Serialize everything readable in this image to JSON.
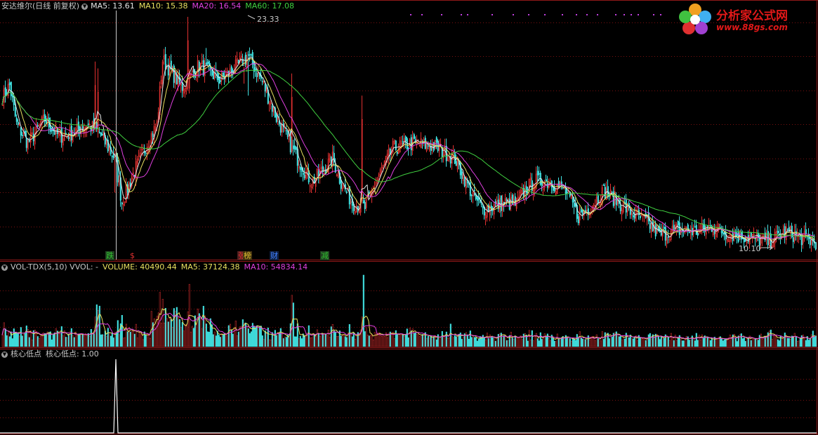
{
  "main_panel": {
    "title": "安达维尔(日线 前复权)",
    "indicators": [
      {
        "label": "MA5: 13.61",
        "color": "#e6e6e6"
      },
      {
        "label": "MA10: 15.38",
        "color": "#e8e060"
      },
      {
        "label": "MA20: 16.54",
        "color": "#e040e0"
      },
      {
        "label": "MA60: 17.08",
        "color": "#40d040"
      }
    ],
    "high_label": "23.33",
    "low_label": "10.10",
    "events": [
      {
        "label": "跌",
        "color": "#30c030",
        "bg": "#204020",
        "index": 74
      },
      {
        "label": "$",
        "color": "#e03030",
        "bg": "",
        "index": 91
      },
      {
        "label": "张",
        "color": "#e03030",
        "bg": "#502020",
        "index": 168
      },
      {
        "label": "榜",
        "color": "#e0c030",
        "bg": "#403010",
        "index": 172
      },
      {
        "label": "财",
        "color": "#4080ff",
        "bg": "#102040",
        "index": 191
      },
      {
        "label": "减",
        "color": "#30c030",
        "bg": "#204020",
        "index": 227
      }
    ]
  },
  "volume_panel": {
    "title": "VOL-TDX(5,10) VVOL: -",
    "indicators": [
      {
        "label": "VOLUME: 40490.44",
        "color": "#e8e060"
      },
      {
        "label": "MA5: 37124.38",
        "color": "#e8e060"
      },
      {
        "label": "MA10: 54834.14",
        "color": "#e040e0"
      }
    ]
  },
  "signal_panel": {
    "title": "核心低点",
    "indicators": [
      {
        "label": "核心低点: 1.00",
        "color": "#c0c0c0"
      }
    ]
  },
  "logo": {
    "brand": "分析家公式网",
    "url": "www.88gs.com"
  },
  "colors": {
    "up": "#e03030",
    "down": "#40e0e0",
    "grid": "#7a1010",
    "frame": "#901818"
  },
  "chart_data": {
    "type": "candlestick",
    "price_range": [
      10.1,
      23.33
    ],
    "x_ticks": [],
    "anchors": [
      [
        0,
        18.6
      ],
      [
        5,
        19.3
      ],
      [
        10,
        17.0
      ],
      [
        18,
        15.9
      ],
      [
        30,
        17.3
      ],
      [
        40,
        16.3
      ],
      [
        50,
        16.5
      ],
      [
        60,
        17.0
      ],
      [
        68,
        16.6
      ],
      [
        80,
        15.0
      ],
      [
        85,
        12.4
      ],
      [
        92,
        13.9
      ],
      [
        103,
        15.9
      ],
      [
        110,
        17.0
      ],
      [
        114,
        20.8
      ],
      [
        128,
        19.2
      ],
      [
        140,
        20.5
      ],
      [
        155,
        19.6
      ],
      [
        175,
        21.0
      ],
      [
        185,
        19.5
      ],
      [
        195,
        17.4
      ],
      [
        210,
        15.0
      ],
      [
        220,
        13.6
      ],
      [
        230,
        14.5
      ],
      [
        235,
        15.0
      ],
      [
        241,
        13.6
      ],
      [
        249,
        12.4
      ],
      [
        258,
        12.1
      ],
      [
        268,
        14.0
      ],
      [
        278,
        15.6
      ],
      [
        293,
        15.9
      ],
      [
        308,
        15.7
      ],
      [
        322,
        15.0
      ],
      [
        335,
        12.8
      ],
      [
        342,
        12.0
      ],
      [
        350,
        12.2
      ],
      [
        358,
        12.4
      ],
      [
        366,
        12.3
      ],
      [
        372,
        13.2
      ],
      [
        380,
        13.7
      ],
      [
        390,
        13.6
      ],
      [
        400,
        13.2
      ],
      [
        410,
        11.6
      ],
      [
        418,
        12.1
      ],
      [
        428,
        13.1
      ],
      [
        436,
        12.6
      ],
      [
        448,
        11.8
      ],
      [
        458,
        11.3
      ],
      [
        468,
        10.5
      ],
      [
        480,
        10.8
      ],
      [
        495,
        10.7
      ],
      [
        505,
        11.0
      ],
      [
        515,
        10.6
      ],
      [
        530,
        10.4
      ],
      [
        545,
        10.1
      ],
      [
        558,
        10.7
      ],
      [
        570,
        10.3
      ],
      [
        578,
        10.1
      ]
    ],
    "spikes": {
      "66": 20.7,
      "68": 20.3,
      "132": 23.33,
      "145": 21.5,
      "172": 19.4,
      "206": 20.0,
      "319": 14.8,
      "256": 18.7
    },
    "dips": {
      "80": 13.0,
      "85": 12.4,
      "90": 12.6,
      "175": 18.7,
      "244": 13.6,
      "258": 12.0
    },
    "signal": {
      "index": 81,
      "value": 1.0
    }
  }
}
